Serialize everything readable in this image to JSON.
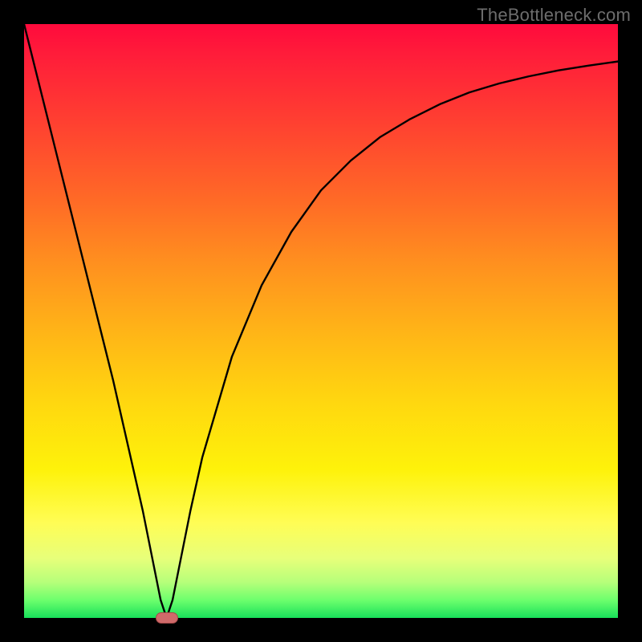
{
  "watermark": "TheBottleneck.com",
  "colors": {
    "frame": "#000000",
    "marker_fill": "#cf6a6a",
    "marker_stroke": "#a94a4a",
    "curve": "#000000"
  },
  "chart_data": {
    "type": "line",
    "title": "",
    "xlabel": "",
    "ylabel": "",
    "xlim": [
      0,
      100
    ],
    "ylim": [
      0,
      100
    ],
    "grid": false,
    "legend": false,
    "note": "Background gradient encodes value: red=high, green=low. Curve is a V-shaped function with its minimum near x≈24.",
    "series": [
      {
        "name": "curve",
        "x": [
          0,
          5,
          10,
          15,
          20,
          22,
          23,
          24,
          25,
          26,
          28,
          30,
          35,
          40,
          45,
          50,
          55,
          60,
          65,
          70,
          75,
          80,
          85,
          90,
          95,
          100
        ],
        "y": [
          100,
          80,
          60,
          40,
          18,
          8,
          3,
          0,
          3,
          8,
          18,
          27,
          44,
          56,
          65,
          72,
          77,
          81,
          84,
          86.5,
          88.5,
          90,
          91.2,
          92.2,
          93,
          93.7
        ]
      }
    ],
    "marker": {
      "x": 24,
      "y": 0,
      "shape": "pill"
    }
  }
}
